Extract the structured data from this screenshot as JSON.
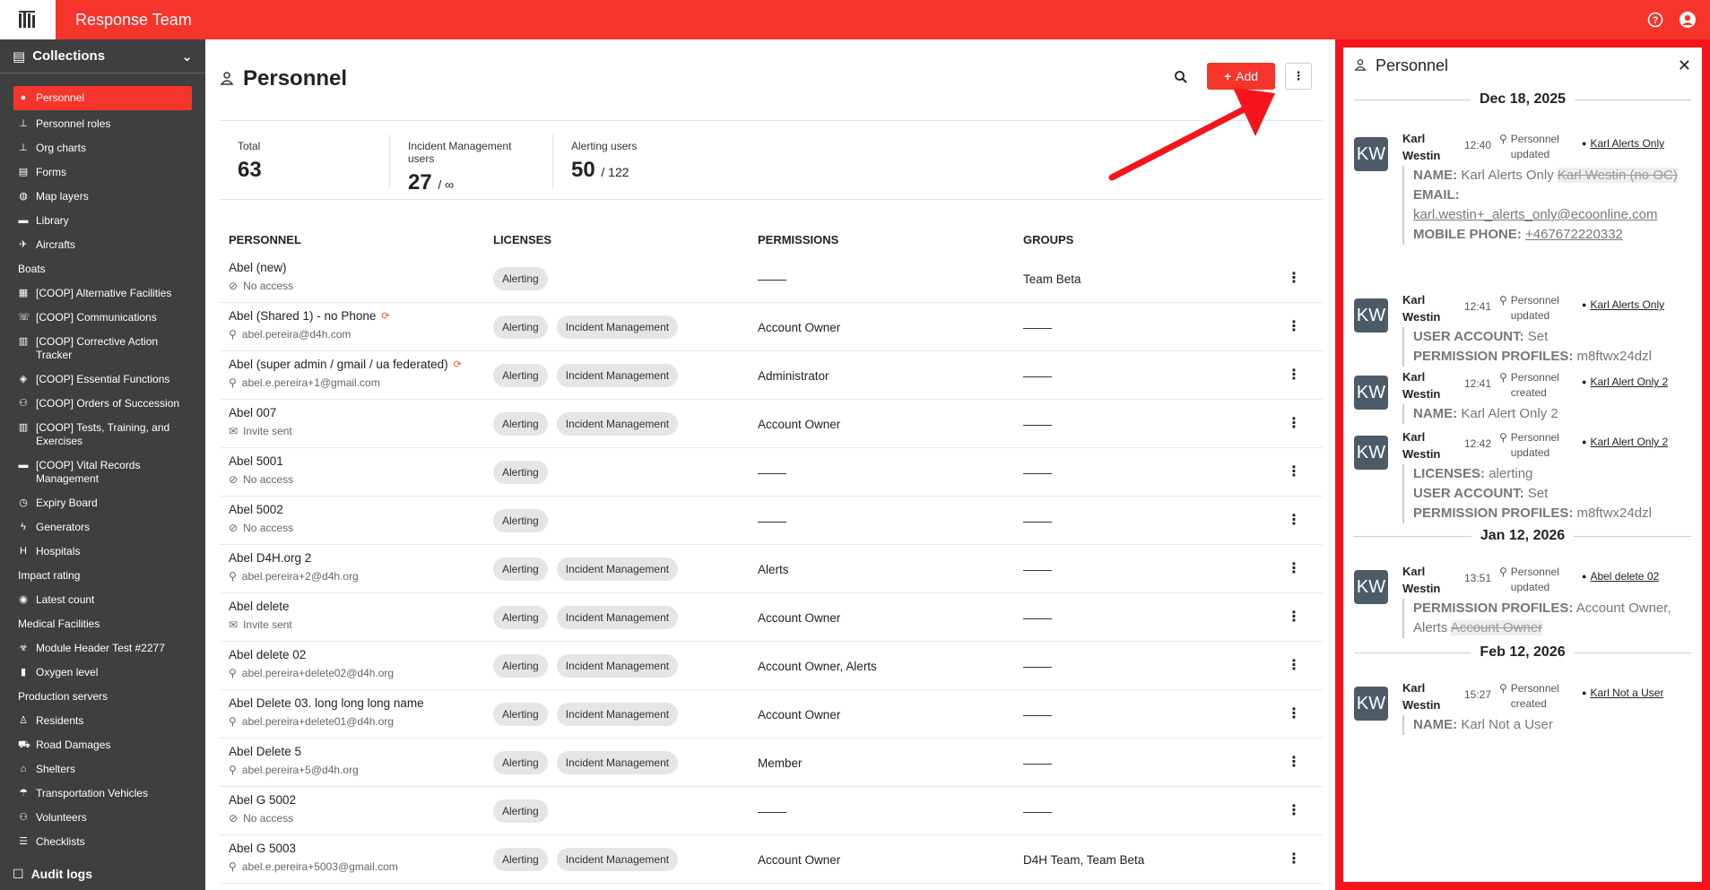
{
  "app": {
    "title": "Response Team",
    "help_icon": "help-circle-icon",
    "user_icon": "account-circle-icon"
  },
  "sidebar": {
    "collections_label": "Collections",
    "items": [
      {
        "label": "Personnel",
        "icon": "person-icon",
        "active": true
      },
      {
        "label": "Personnel roles",
        "icon": "hierarchy-icon"
      },
      {
        "label": "Org charts",
        "icon": "hierarchy-icon"
      },
      {
        "label": "Forms",
        "icon": "document-icon"
      },
      {
        "label": "Map layers",
        "icon": "globe-icon"
      },
      {
        "label": "Library",
        "icon": "folder-icon"
      },
      {
        "label": "Aircrafts",
        "icon": "plane-icon"
      },
      {
        "label": "Boats",
        "icon": ""
      },
      {
        "label": "[COOP] Alternative Facilities",
        "icon": "building-icon"
      },
      {
        "label": "[COOP] Communications",
        "icon": "phone-icon"
      },
      {
        "label": "[COOP] Corrective Action Tracker",
        "icon": "clipboard-icon"
      },
      {
        "label": "[COOP] Essential Functions",
        "icon": "shield-icon"
      },
      {
        "label": "[COOP] Orders of Succession",
        "icon": "users-icon"
      },
      {
        "label": "[COOP] Tests, Training, and Exercises",
        "icon": "clipboard-icon"
      },
      {
        "label": "[COOP] Vital Records Management",
        "icon": "folder-icon"
      },
      {
        "label": "Expiry Board",
        "icon": "clock-icon"
      },
      {
        "label": "Generators",
        "icon": "bolt-icon"
      },
      {
        "label": "Hospitals",
        "icon": "hospital-icon"
      },
      {
        "label": "Impact rating",
        "icon": ""
      },
      {
        "label": "Latest count",
        "icon": "circle-icon"
      },
      {
        "label": "Medical Facilities",
        "icon": ""
      },
      {
        "label": "Module Header Test #2277",
        "icon": "biohazard-icon"
      },
      {
        "label": "Oxygen level",
        "icon": "tank-icon"
      },
      {
        "label": "Production servers",
        "icon": ""
      },
      {
        "label": "Residents",
        "icon": "person-standing-icon"
      },
      {
        "label": "Road Damages",
        "icon": "road-icon"
      },
      {
        "label": "Shelters",
        "icon": "home-icon"
      },
      {
        "label": "Transportation Vehicles",
        "icon": "umbrella-icon"
      },
      {
        "label": "Volunteers",
        "icon": "users-icon"
      },
      {
        "label": "Checklists",
        "icon": "checklist-icon"
      }
    ],
    "audit_label": "Audit logs"
  },
  "main": {
    "title": "Personnel",
    "add_label": "Add",
    "stats": [
      {
        "label": "Total",
        "value": "63",
        "suffix": ""
      },
      {
        "label": "Incident Management users",
        "value": "27",
        "suffix": "/ ∞"
      },
      {
        "label": "Alerting users",
        "value": "50",
        "suffix": "/ 122"
      }
    ],
    "columns": [
      "PERSONNEL",
      "LICENSES",
      "PERMISSIONS",
      "GROUPS"
    ],
    "rows": [
      {
        "name": "Abel (new)",
        "sub": "No access",
        "sub_icon": "no-access-icon",
        "licenses": [
          "Alerting"
        ],
        "permissions": "",
        "groups": "Team Beta",
        "federated": false
      },
      {
        "name": "Abel (Shared 1) - no Phone",
        "sub": "abel.pereira@d4h.com",
        "sub_icon": "person-icon",
        "licenses": [
          "Alerting",
          "Incident Management"
        ],
        "permissions": "Account Owner",
        "groups": "",
        "federated": true
      },
      {
        "name": "Abel (super admin / gmail / ua federated)",
        "sub": "abel.e.pereira+1@gmail.com",
        "sub_icon": "person-icon",
        "licenses": [
          "Alerting",
          "Incident Management"
        ],
        "permissions": "Administrator",
        "groups": "",
        "federated": true
      },
      {
        "name": "Abel 007",
        "sub": "Invite sent",
        "sub_icon": "mail-icon",
        "licenses": [
          "Alerting",
          "Incident Management"
        ],
        "permissions": "Account Owner",
        "groups": "",
        "federated": false
      },
      {
        "name": "Abel 5001",
        "sub": "No access",
        "sub_icon": "no-access-icon",
        "licenses": [
          "Alerting"
        ],
        "permissions": "",
        "groups": "",
        "federated": false
      },
      {
        "name": "Abel 5002",
        "sub": "No access",
        "sub_icon": "no-access-icon",
        "licenses": [
          "Alerting"
        ],
        "permissions": "",
        "groups": "",
        "federated": false
      },
      {
        "name": "Abel D4H.org 2",
        "sub": "abel.pereira+2@d4h.org",
        "sub_icon": "person-icon",
        "licenses": [
          "Alerting",
          "Incident Management"
        ],
        "permissions": "Alerts",
        "groups": "",
        "federated": false
      },
      {
        "name": "Abel delete",
        "sub": "Invite sent",
        "sub_icon": "mail-icon",
        "licenses": [
          "Alerting",
          "Incident Management"
        ],
        "permissions": "Account Owner",
        "groups": "",
        "federated": false
      },
      {
        "name": "Abel delete 02",
        "sub": "abel.pereira+delete02@d4h.org",
        "sub_icon": "person-icon",
        "licenses": [
          "Alerting",
          "Incident Management"
        ],
        "permissions": "Account Owner, Alerts",
        "groups": "",
        "federated": false
      },
      {
        "name": "Abel Delete 03. long long long name",
        "sub": "abel.pereira+delete01@d4h.org",
        "sub_icon": "person-icon",
        "licenses": [
          "Alerting",
          "Incident Management"
        ],
        "permissions": "Account Owner",
        "groups": "",
        "federated": false
      },
      {
        "name": "Abel Delete 5",
        "sub": "abel.pereira+5@d4h.org",
        "sub_icon": "person-icon",
        "licenses": [
          "Alerting",
          "Incident Management"
        ],
        "permissions": "Member",
        "groups": "",
        "federated": false
      },
      {
        "name": "Abel G 5002",
        "sub": "No access",
        "sub_icon": "no-access-icon",
        "licenses": [
          "Alerting"
        ],
        "permissions": "",
        "groups": "",
        "federated": false
      },
      {
        "name": "Abel G 5003",
        "sub": "abel.e.pereira+5003@gmail.com",
        "sub_icon": "person-icon",
        "licenses": [
          "Alerting",
          "Incident Management"
        ],
        "permissions": "Account Owner",
        "groups": "D4H Team, Team Beta",
        "federated": false
      }
    ]
  },
  "panel": {
    "title": "Personnel",
    "groups": [
      {
        "date": "Dec 18, 2025",
        "activities": [
          {
            "initials": "KW",
            "first": "Karl",
            "last": "Westin",
            "time": "12:40",
            "type1": "Personnel",
            "type2": "updated",
            "user": "Karl Alerts Only",
            "lines": [
              {
                "key": "NAME:",
                "value": "Karl Alerts Only",
                "old": "Karl Westin (no OC)"
              },
              {
                "key": "EMAIL:",
                "value": "",
                "old": ""
              },
              {
                "key": "",
                "value": "karl.westin+_alerts_only@ecoonline.com",
                "old": "",
                "link": true
              },
              {
                "key": "MOBILE PHONE:",
                "value": "+467672220332",
                "old": "",
                "link": true
              }
            ]
          },
          {
            "initials": "KW",
            "first": "Karl",
            "last": "Westin",
            "time": "12:41",
            "type1": "Personnel",
            "type2": "updated",
            "user": "Karl Alerts Only",
            "lines": [
              {
                "key": "USER ACCOUNT:",
                "value": "Set",
                "old": ""
              },
              {
                "key": "PERMISSION PROFILES:",
                "value": "m8ftwx24dzl",
                "old": ""
              }
            ]
          },
          {
            "initials": "KW",
            "first": "Karl",
            "last": "Westin",
            "time": "12:41",
            "type1": "Personnel",
            "type2": "created",
            "user": "Karl Alert Only 2",
            "lines": [
              {
                "key": "NAME:",
                "value": "Karl Alert Only 2",
                "old": ""
              }
            ]
          },
          {
            "initials": "KW",
            "first": "Karl",
            "last": "Westin",
            "time": "12:42",
            "type1": "Personnel",
            "type2": "updated",
            "user": "Karl Alert Only 2",
            "lines": [
              {
                "key": "LICENSES:",
                "value": "alerting",
                "old": ""
              },
              {
                "key": "USER ACCOUNT:",
                "value": "Set",
                "old": ""
              },
              {
                "key": "PERMISSION PROFILES:",
                "value": "m8ftwx24dzl",
                "old": ""
              }
            ]
          }
        ]
      },
      {
        "date": "Jan 12, 2026",
        "activities": [
          {
            "initials": "KW",
            "first": "Karl",
            "last": "Westin",
            "time": "13:51",
            "type1": "Personnel",
            "type2": "updated",
            "user": "Abel delete 02",
            "lines": [
              {
                "key": "PERMISSION PROFILES:",
                "value": "Account Owner, Alerts",
                "old": "Account Owner"
              }
            ]
          }
        ]
      },
      {
        "date": "Feb 12, 2026",
        "activities": [
          {
            "initials": "KW",
            "first": "Karl",
            "last": "Westin",
            "time": "15:27",
            "type1": "Personnel",
            "type2": "created",
            "user": "Karl Not a User",
            "lines": [
              {
                "key": "NAME:",
                "value": "Karl Not a User",
                "old": ""
              }
            ]
          }
        ]
      }
    ]
  }
}
